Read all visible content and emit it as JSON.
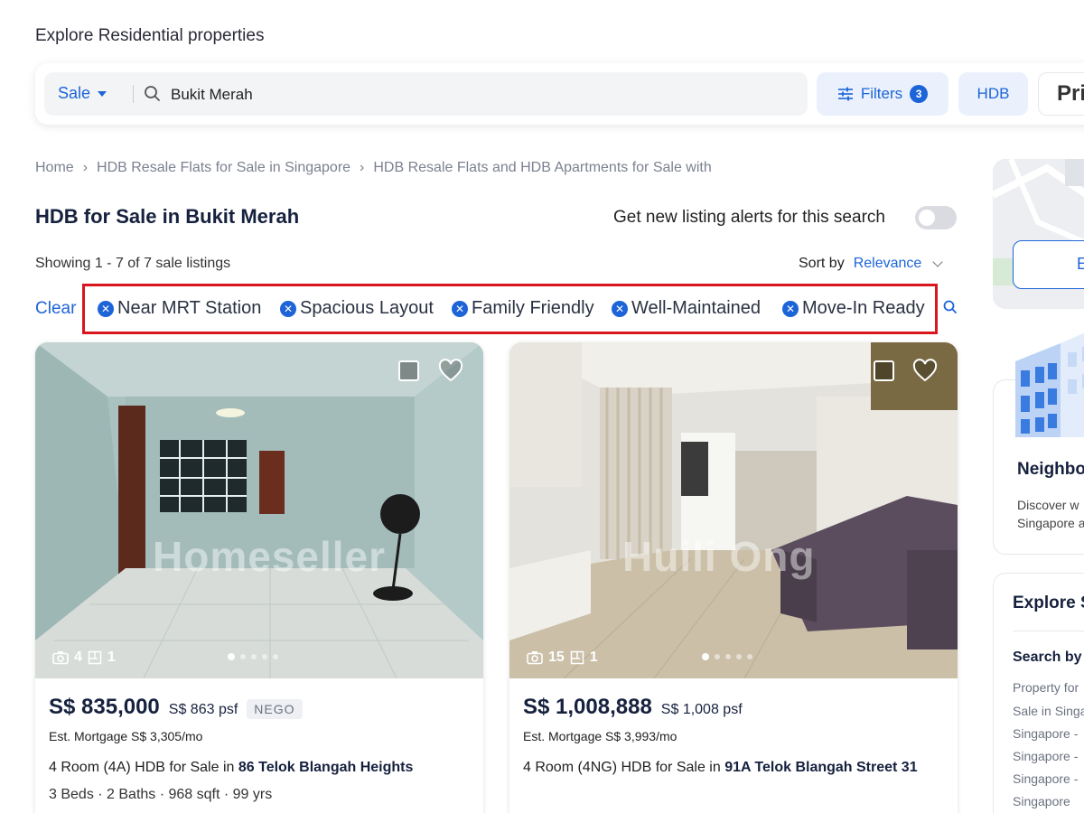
{
  "header": {
    "title": "Explore Residential properties"
  },
  "search": {
    "mode": "Sale",
    "query": "Bukit Merah",
    "filters_label": "Filters",
    "filters_count": "3",
    "hdb_label": "HDB",
    "price_label": "Pric"
  },
  "breadcrumb": [
    "Home",
    "HDB Resale Flats for Sale in Singapore",
    "HDB Resale Flats and HDB Apartments for Sale with"
  ],
  "page": {
    "title": "HDB for Sale in Bukit Merah",
    "alert_label": "Get new listing alerts for this search",
    "showing": "Showing 1 - 7 of 7 sale listings",
    "sort_label": "Sort by",
    "sort_value": "Relevance",
    "clear_label": "Clear"
  },
  "tags": [
    "Near MRT Station",
    "Spacious Layout",
    "Family Friendly",
    "Well-Maintained",
    "Move-In Ready"
  ],
  "listings": [
    {
      "watermark": "Homeseller",
      "photos": "4",
      "floorplans": "1",
      "price": "S$ 835,000",
      "psf": "S$ 863 psf",
      "badge": "NEGO",
      "mortgage": "Est. Mortgage S$ 3,305/mo",
      "title_prefix": "4 Room (4A) HDB for Sale in ",
      "title_bold": "86 Telok Blangah Heights",
      "specs": "3 Beds · 2 Baths · 968 sqft · 99 yrs"
    },
    {
      "watermark": "Huili Ong",
      "photos": "15",
      "floorplans": "1",
      "price": "S$ 1,008,888",
      "psf": "S$ 1,008 psf",
      "mortgage": "Est. Mortgage S$ 3,993/mo",
      "title_prefix": "4 Room (4NG) HDB for Sale in ",
      "title_bold": "91A Telok Blangah Street 31"
    }
  ],
  "sidebar": {
    "map_button": "E",
    "neighbourhood_title": "Neighbo",
    "neighbourhood_text_1": "Discover w",
    "neighbourhood_text_2": "Singapore a",
    "explore_title": "Explore S",
    "search_by": "Search by",
    "links": [
      "Property for",
      "Sale in Singa",
      "Singapore -",
      "Singapore -",
      "Singapore -",
      "Singapore"
    ]
  },
  "colors": {
    "accent": "#1d64d8",
    "highlight_border": "#d9161e",
    "title": "#16213e"
  },
  "icons": [
    "search-icon",
    "caret-down-icon",
    "sliders-icon",
    "remove-tag-icon",
    "heart-icon",
    "camera-icon",
    "floorplan-icon",
    "chevron-down-icon",
    "building-icon"
  ]
}
